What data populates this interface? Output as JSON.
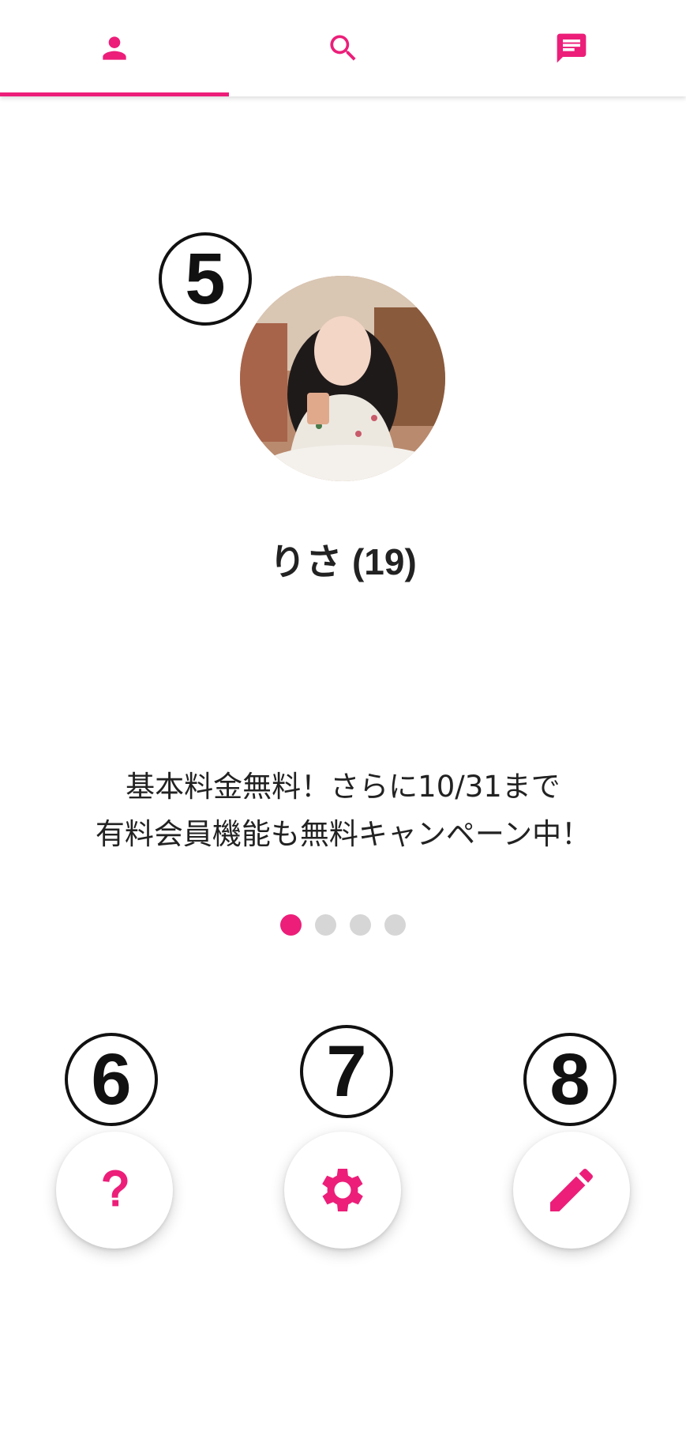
{
  "theme": {
    "accent": "#ec1e79",
    "inactive_dot": "#d6d6d6"
  },
  "tabs": [
    {
      "icon": "person-icon",
      "active": true
    },
    {
      "icon": "search-icon",
      "active": false
    },
    {
      "icon": "chat-icon",
      "active": false
    }
  ],
  "profile": {
    "name_age": "りさ (19)"
  },
  "promo": {
    "line1": "基本料金無料！さらに10/31まで",
    "line2": "有料会員機能も無料キャンペーン中！"
  },
  "carousel": {
    "page_count": 4,
    "active_index": 0
  },
  "actions": [
    {
      "icon": "help-icon"
    },
    {
      "icon": "settings-icon"
    },
    {
      "icon": "edit-icon"
    }
  ],
  "markers": {
    "m5": "5",
    "m6": "6",
    "m7": "7",
    "m8": "8"
  }
}
